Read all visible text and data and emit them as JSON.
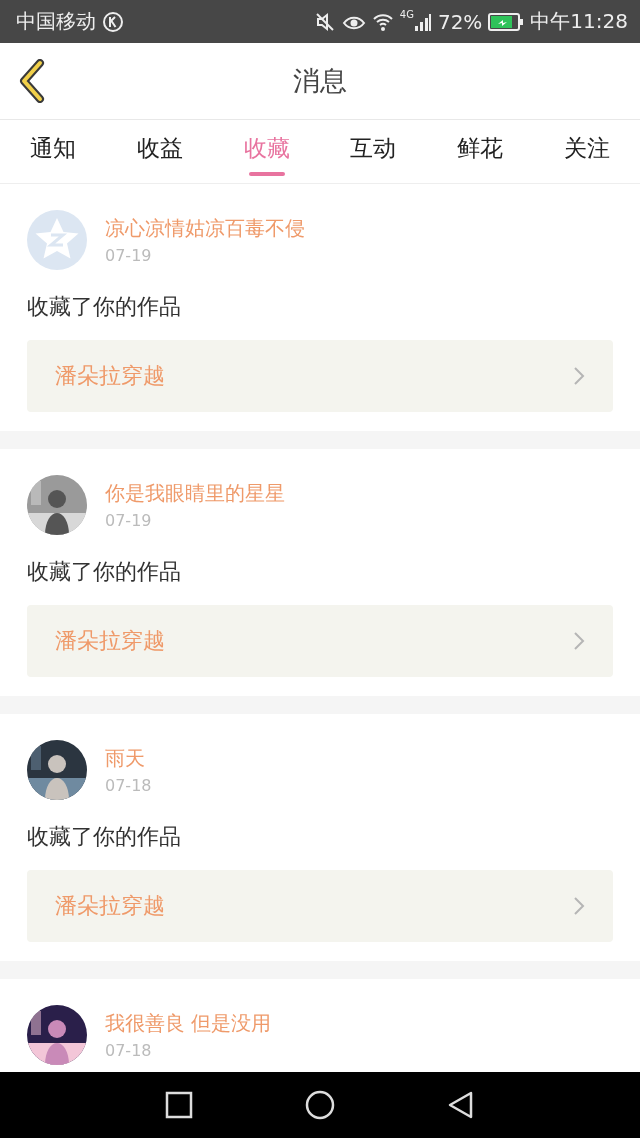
{
  "status_bar": {
    "carrier": "中国移动",
    "network": "4G",
    "battery": "72%",
    "time": "中午11:28"
  },
  "header": {
    "title": "消息"
  },
  "tabs": [
    {
      "label": "通知",
      "selected": false
    },
    {
      "label": "收益",
      "selected": false
    },
    {
      "label": "收藏",
      "selected": true
    },
    {
      "label": "互动",
      "selected": false
    },
    {
      "label": "鲜花",
      "selected": false
    },
    {
      "label": "关注",
      "selected": false
    }
  ],
  "messages": [
    {
      "avatar": {
        "kind": "default"
      },
      "name": "凉心凉情姑凉百毒不侵",
      "date": "07-19",
      "action": "收藏了你的作品",
      "work": "潘朵拉穿越"
    },
    {
      "name": "你是我眼睛里的星星",
      "date": "07-19",
      "action": "收藏了你的作品",
      "work": "潘朵拉穿越"
    },
    {
      "name": "雨天",
      "date": "07-18",
      "action": "收藏了你的作品",
      "work": "潘朵拉穿越"
    },
    {
      "name": "我很善良 但是没用",
      "date": "07-18"
    }
  ]
}
